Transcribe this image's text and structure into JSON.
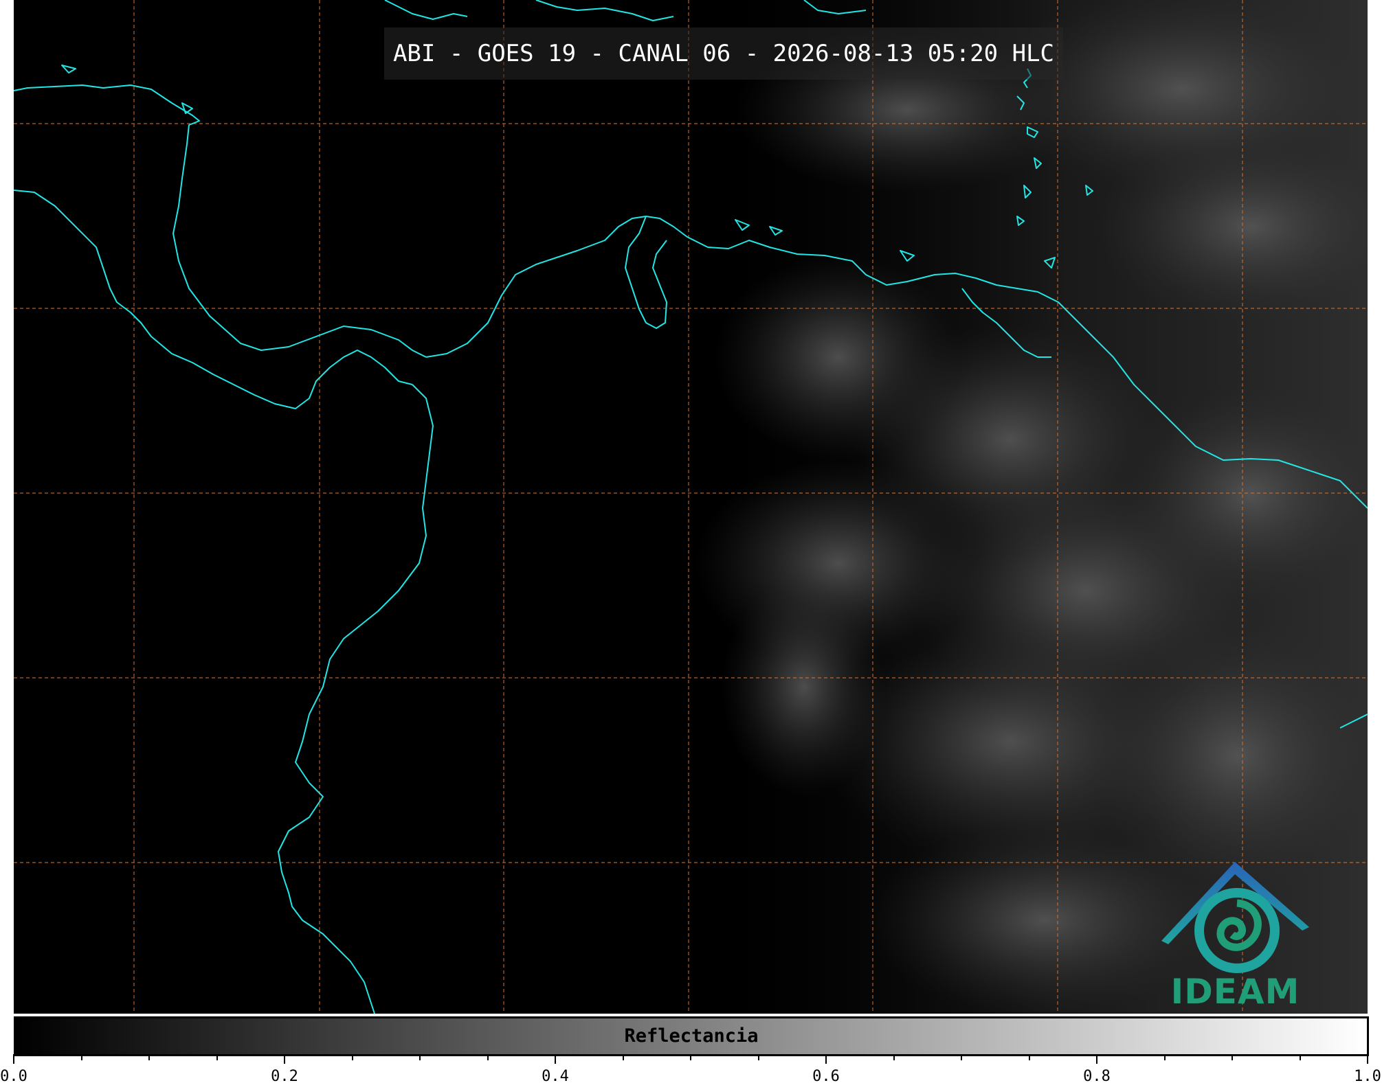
{
  "title": "ABI - GOES 19 - CANAL 06 - 2026-08-13 05:20 HLC",
  "colorbar": {
    "label": "Reflectancia",
    "range": [
      0.0,
      1.0
    ],
    "colors": [
      "#000000",
      "#ffffff"
    ],
    "major_ticks": [
      "0.0",
      "0.2",
      "0.4",
      "0.6",
      "0.8",
      "1.0"
    ],
    "minor_tick_count": 20
  },
  "map": {
    "background_color": "#000000",
    "coastline_color": "#22e6e6",
    "grid_color": "#d9702a",
    "grid_style": "dashed"
  },
  "logo": {
    "text": "IDEAM",
    "colors": [
      "#2a64b8",
      "#1fa4a0",
      "#1f9e78"
    ]
  }
}
